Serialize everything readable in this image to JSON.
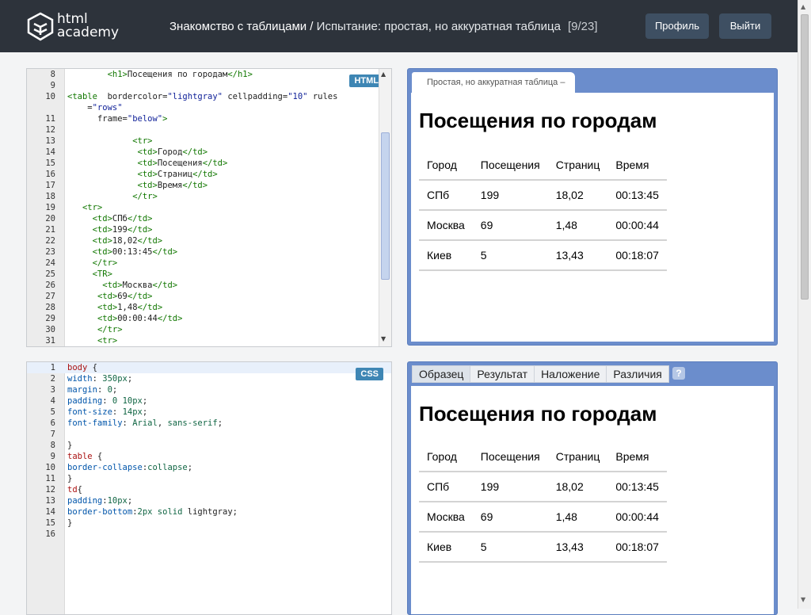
{
  "header": {
    "logo_line1": "html",
    "logo_line2": "academy",
    "course": "Знакомство с таблицами",
    "separator": " / ",
    "task": "Испытание: простая, но аккуратная таблица",
    "progress": "[9/23]",
    "profile_btn": "Профиль",
    "logout_btn": "Выйти"
  },
  "html_editor": {
    "badge": "HTML",
    "lines": [
      {
        "n": "8",
        "html": "        <span class='tg'>&lt;h1&gt;</span>Посещения по городам<span class='tg'>&lt;/h1&gt;</span>"
      },
      {
        "n": "9",
        "html": ""
      },
      {
        "n": "10",
        "html": "<span class='tg'>&lt;table</span>  <span class='at'>bordercolor</span>=<span class='str'>\"lightgray\"</span> <span class='at'>cellpadding</span>=<span class='str'>\"10\"</span> <span class='at'>rules</span>"
      },
      {
        "n": "",
        "html": "    =<span class='str'>\"rows\"</span>"
      },
      {
        "n": "11",
        "html": "      <span class='at'>frame</span>=<span class='str'>\"below\"</span><span class='tg'>&gt;</span>"
      },
      {
        "n": "12",
        "html": ""
      },
      {
        "n": "13",
        "html": "             <span class='tg'>&lt;tr&gt;</span>"
      },
      {
        "n": "14",
        "html": "              <span class='tg'>&lt;td&gt;</span>Город<span class='tg'>&lt;/td&gt;</span>"
      },
      {
        "n": "15",
        "html": "              <span class='tg'>&lt;td&gt;</span>Посещения<span class='tg'>&lt;/td&gt;</span>"
      },
      {
        "n": "16",
        "html": "              <span class='tg'>&lt;td&gt;</span>Страниц<span class='tg'>&lt;/td&gt;</span>"
      },
      {
        "n": "17",
        "html": "              <span class='tg'>&lt;td&gt;</span>Время<span class='tg'>&lt;/td&gt;</span>"
      },
      {
        "n": "18",
        "html": "             <span class='tg'>&lt;/tr&gt;</span>"
      },
      {
        "n": "19",
        "html": "   <span class='tg'>&lt;tr&gt;</span>"
      },
      {
        "n": "20",
        "html": "     <span class='tg'>&lt;td&gt;</span>СПб<span class='tg'>&lt;/td&gt;</span>"
      },
      {
        "n": "21",
        "html": "     <span class='tg'>&lt;td&gt;</span>199<span class='tg'>&lt;/td&gt;</span>"
      },
      {
        "n": "22",
        "html": "     <span class='tg'>&lt;td&gt;</span>18,02<span class='tg'>&lt;/td&gt;</span>"
      },
      {
        "n": "23",
        "html": "     <span class='tg'>&lt;td&gt;</span>00:13:45<span class='tg'>&lt;/td&gt;</span>"
      },
      {
        "n": "24",
        "html": "     <span class='tg'>&lt;/tr&gt;</span>"
      },
      {
        "n": "25",
        "html": "     <span class='tg'>&lt;TR&gt;</span>"
      },
      {
        "n": "26",
        "html": "       <span class='tg'>&lt;td&gt;</span>Москва<span class='tg'>&lt;/td&gt;</span>"
      },
      {
        "n": "27",
        "html": "      <span class='tg'>&lt;td&gt;</span>69<span class='tg'>&lt;/td&gt;</span>"
      },
      {
        "n": "28",
        "html": "      <span class='tg'>&lt;td&gt;</span>1,48<span class='tg'>&lt;/td&gt;</span>"
      },
      {
        "n": "29",
        "html": "      <span class='tg'>&lt;td&gt;</span>00:00:44<span class='tg'>&lt;/td&gt;</span>"
      },
      {
        "n": "30",
        "html": "      <span class='tg'>&lt;/tr&gt;</span>"
      },
      {
        "n": "31",
        "html": "      <span class='tg'>&lt;tr&gt;</span>"
      }
    ]
  },
  "css_editor": {
    "badge": "CSS",
    "lines": [
      {
        "n": "1",
        "html": "<span class='sel'>body</span> {"
      },
      {
        "n": "2",
        "html": "<span class='prop'>width</span>: <span class='val'>350px</span>;"
      },
      {
        "n": "3",
        "html": "<span class='prop'>margin</span>: <span class='val'>0</span>;"
      },
      {
        "n": "4",
        "html": "<span class='prop'>padding</span>: <span class='val'>0 10px</span>;"
      },
      {
        "n": "5",
        "html": "<span class='prop'>font-size</span>: <span class='val'>14px</span>;"
      },
      {
        "n": "6",
        "html": "<span class='prop'>font-family</span>: <span class='val'>Arial</span>, <span class='val'>sans-serif</span>;"
      },
      {
        "n": "7",
        "html": ""
      },
      {
        "n": "8",
        "html": "}"
      },
      {
        "n": "9",
        "html": "<span class='sel'>table</span> {"
      },
      {
        "n": "10",
        "html": "<span class='prop'>border-collapse</span>:<span class='val'>collapse</span>;"
      },
      {
        "n": "11",
        "html": "}"
      },
      {
        "n": "12",
        "html": "<span class='sel'>td</span>{"
      },
      {
        "n": "13",
        "html": "<span class='prop'>padding</span>:<span class='val'>10px</span>;"
      },
      {
        "n": "14",
        "html": "<span class='prop'>border-bottom</span>:<span class='val'>2px solid</span> lightgray;"
      },
      {
        "n": "15",
        "html": "}"
      },
      {
        "n": "16",
        "html": ""
      }
    ]
  },
  "preview": {
    "tab_label": "Простая, но аккуратная таблица –",
    "heading": "Посещения по городам",
    "rows": [
      [
        "Город",
        "Посещения",
        "Страниц",
        "Время"
      ],
      [
        "СПб",
        "199",
        "18,02",
        "00:13:45"
      ],
      [
        "Москва",
        "69",
        "1,48",
        "00:00:44"
      ],
      [
        "Киев",
        "5",
        "13,43",
        "00:18:07"
      ]
    ]
  },
  "compare": {
    "tabs": [
      "Образец",
      "Результат",
      "Наложение",
      "Различия"
    ],
    "active_tab": "Образец",
    "help": "?",
    "heading": "Посещения по городам",
    "rows": [
      [
        "Город",
        "Посещения",
        "Страниц",
        "Время"
      ],
      [
        "СПб",
        "199",
        "18,02",
        "00:13:45"
      ],
      [
        "Москва",
        "69",
        "1,48",
        "00:00:44"
      ],
      [
        "Киев",
        "5",
        "13,43",
        "00:18:07"
      ]
    ]
  }
}
